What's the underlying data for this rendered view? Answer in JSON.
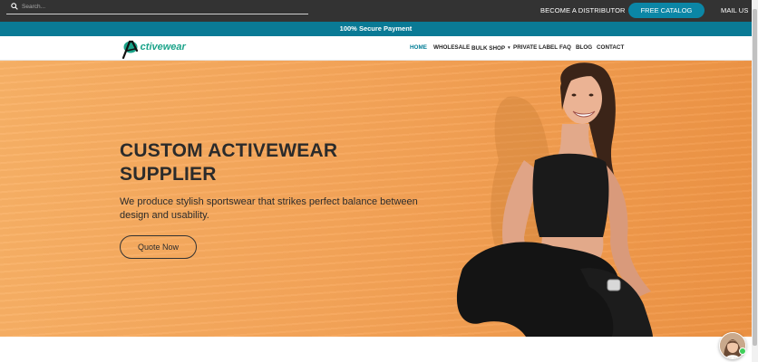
{
  "topbar": {
    "search_placeholder": "Search...",
    "become_distributor": "BECOME A DISTRIBUTOR",
    "free_catalog": "FREE CATALOG",
    "mail_us": "MAIL US"
  },
  "secure_banner": "100% Secure Payment",
  "logo": {
    "first_letter": "A",
    "rest": "ctivewear"
  },
  "nav": {
    "home": "HOME",
    "wholesale": "WHOLESALE",
    "bulk_shop": "BULK SHOP",
    "private_label": "PRIVATE LABEL",
    "faq": "FAQ",
    "blog": "BLOG",
    "contact": "CONTACT"
  },
  "hero": {
    "title_line1": "CUSTOM ACTIVEWEAR",
    "title_line2": "SUPPLIER",
    "subtitle": "We produce stylish sportswear that strikes perfect balance between design and usability.",
    "cta": "Quote Now"
  },
  "colors": {
    "topbar_bg": "#333333",
    "accent_teal": "#007d96",
    "banner_bg": "#0a7a95",
    "catalog_btn": "#0b86a6",
    "logo_green": "#1aa389",
    "hero_orange": "#f6a559"
  },
  "icons": {
    "search": "search-icon",
    "chevron": "chevron-down-icon",
    "chat": "chat-avatar"
  }
}
